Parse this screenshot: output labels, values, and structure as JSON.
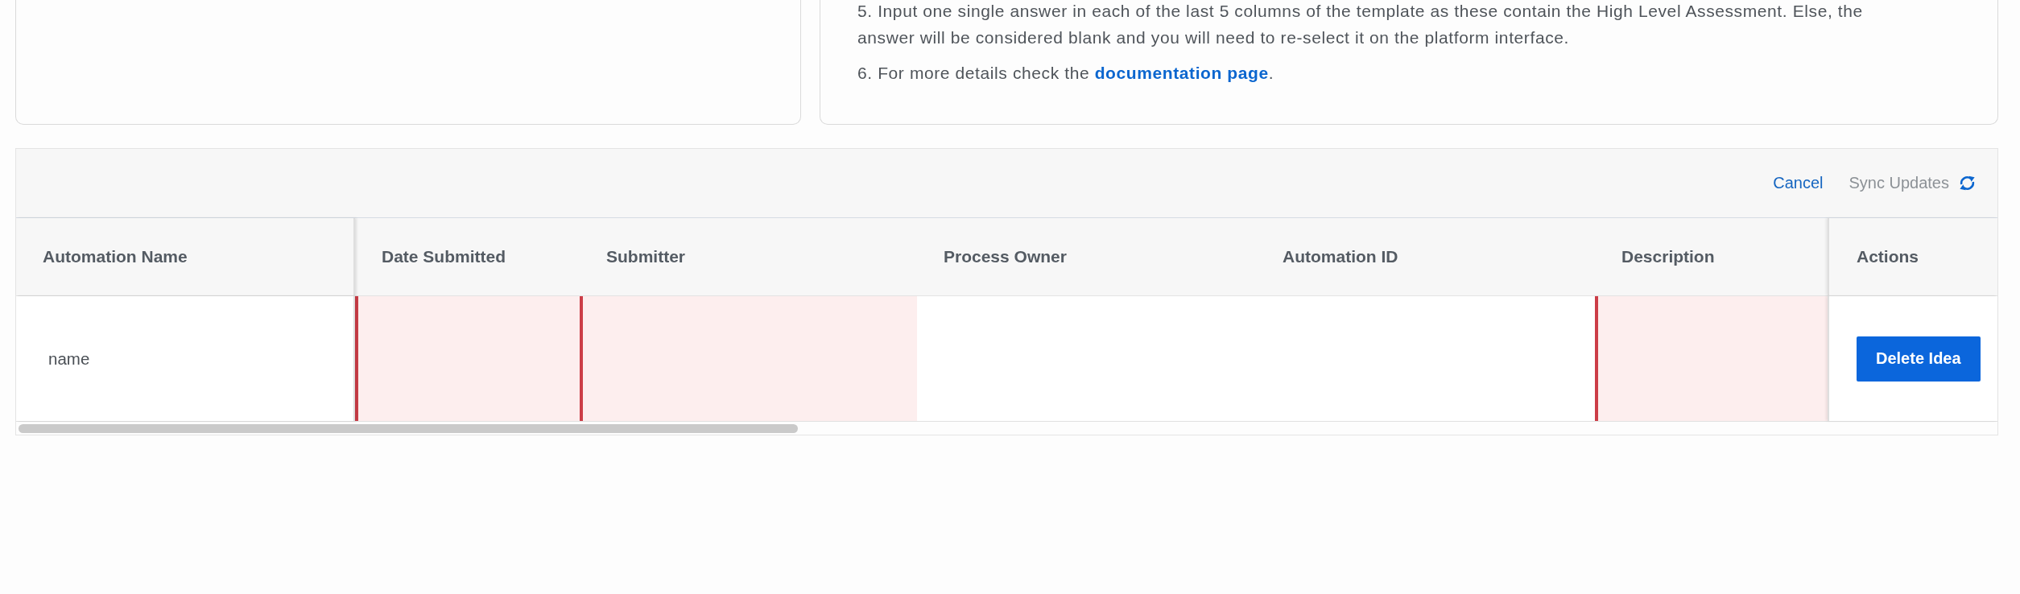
{
  "instructions_card": {
    "items": [
      {
        "text": "5. Input one single answer in each of the last 5 columns of the template as these contain the High Level Assessment. Else, the answer will be considered blank and you will need to re-select it on the platform interface."
      },
      {
        "text": "6. For more details check the ",
        "link": "documentation page",
        "suffix": "."
      }
    ]
  },
  "toolbar": {
    "cancel": "Cancel",
    "sync": {
      "label": "Sync Updates",
      "disabled": true
    }
  },
  "table": {
    "columns": [
      {
        "label": "Automation Name",
        "pinned": true
      },
      {
        "label": "Date Submitted",
        "pinned": false
      },
      {
        "label": "Submitter",
        "pinned": false
      },
      {
        "label": "Process Owner",
        "pinned": false
      },
      {
        "label": "Automation ID",
        "pinned": false
      },
      {
        "label": "Description",
        "pinned": false
      },
      {
        "label": "Actions",
        "pinned": true
      }
    ],
    "rows": [
      {
        "cells": [
          {
            "kind": "text",
            "value": "name",
            "error": false
          },
          {
            "kind": "text",
            "error": true
          },
          {
            "kind": "text",
            "error": true
          },
          {
            "kind": "text",
            "error": false
          },
          {
            "kind": "text",
            "error": false
          },
          {
            "kind": "text",
            "error": true
          },
          {
            "kind": "button",
            "label": "Delete Idea",
            "error": false
          }
        ]
      }
    ]
  }
}
